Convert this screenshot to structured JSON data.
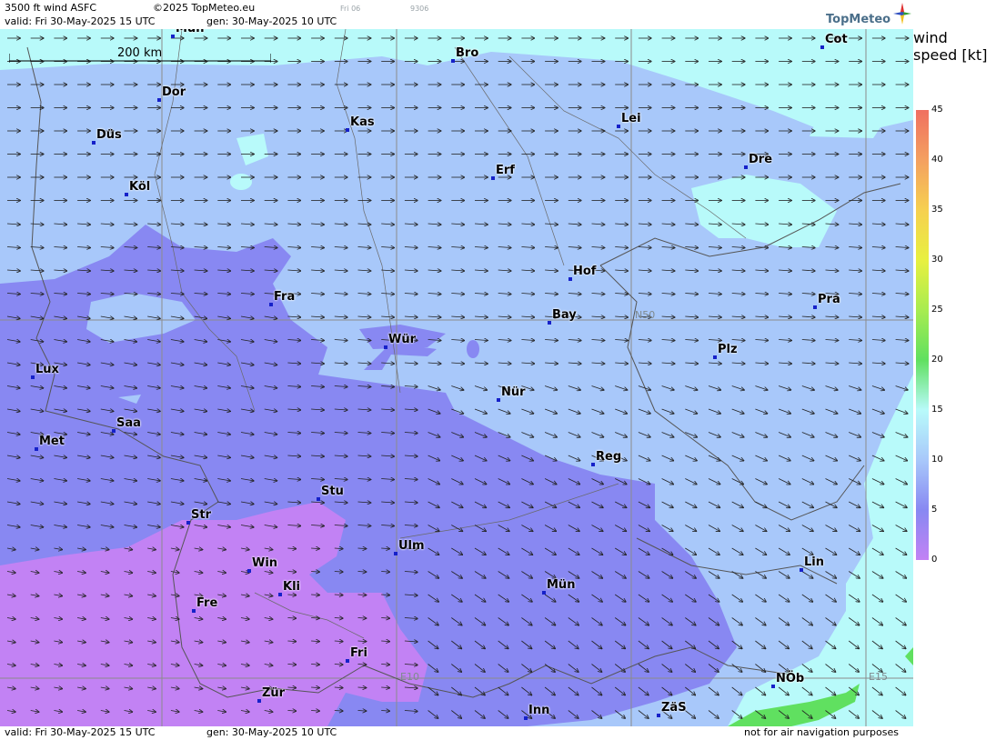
{
  "header": {
    "product": "3500 ft wind ASFC",
    "copyright": "©2025 TopMeteo.eu",
    "day_code": "Fri 06",
    "run_code": "9306",
    "valid": "valid:  Fri  30-May-2025  15 UTC",
    "gen": "gen:  30-May-2025 10 UTC",
    "logo": "TopMeteo"
  },
  "footer": {
    "valid": "valid:  Fri  30-May-2025  15 UTC",
    "gen": "gen:  30-May-2025 10 UTC",
    "disclaimer": "not for air navigation purposes"
  },
  "map": {
    "scale_label": "200 km",
    "grid_labels": {
      "n50": "N50",
      "e10": "E10",
      "e15": "E15"
    },
    "cities": [
      {
        "name": "Mün_top",
        "label": "Mün"
      },
      {
        "name": "Bro",
        "label": "Bro"
      },
      {
        "name": "Cot",
        "label": "Cot"
      },
      {
        "name": "Dor",
        "label": "Dor"
      },
      {
        "name": "Kas",
        "label": "Kas"
      },
      {
        "name": "Lei",
        "label": "Lei"
      },
      {
        "name": "Düs",
        "label": "Düs"
      },
      {
        "name": "Erf",
        "label": "Erf"
      },
      {
        "name": "Dre",
        "label": "Dre"
      },
      {
        "name": "Köl",
        "label": "Köl"
      },
      {
        "name": "Hof",
        "label": "Hof"
      },
      {
        "name": "Fra",
        "label": "Fra"
      },
      {
        "name": "Pra",
        "label": "Pra"
      },
      {
        "name": "Bay",
        "label": "Bay"
      },
      {
        "name": "Wür",
        "label": "Wür"
      },
      {
        "name": "Plz",
        "label": "Plz"
      },
      {
        "name": "Lux",
        "label": "Lux"
      },
      {
        "name": "Nür",
        "label": "Nür"
      },
      {
        "name": "Saa",
        "label": "Saa"
      },
      {
        "name": "Met",
        "label": "Met"
      },
      {
        "name": "Reg",
        "label": "Reg"
      },
      {
        "name": "Stu",
        "label": "Stu"
      },
      {
        "name": "Str",
        "label": "Str"
      },
      {
        "name": "Ulm",
        "label": "Ulm"
      },
      {
        "name": "Win",
        "label": "Win"
      },
      {
        "name": "Lin",
        "label": "Lin"
      },
      {
        "name": "Kli",
        "label": "Kli"
      },
      {
        "name": "Mün",
        "label": "Mün"
      },
      {
        "name": "Fre",
        "label": "Fre"
      },
      {
        "name": "Fri",
        "label": "Fri"
      },
      {
        "name": "NÖb",
        "label": "NÖb"
      },
      {
        "name": "Zür",
        "label": "Zür"
      },
      {
        "name": "Inn",
        "label": "Inn"
      },
      {
        "name": "ZäS",
        "label": "ZäS"
      }
    ]
  },
  "legend": {
    "title": "wind  speed  [kt]",
    "ticks": [
      "45",
      "40",
      "35",
      "30",
      "25",
      "20",
      "15",
      "10",
      "5",
      "0"
    ],
    "colors": [
      "#f07060",
      "#f4a060",
      "#f6d050",
      "#e8f040",
      "#a8ec50",
      "#60e060",
      "#b8fafa",
      "#a8c8fa",
      "#8888f2",
      "#c282f4"
    ]
  }
}
